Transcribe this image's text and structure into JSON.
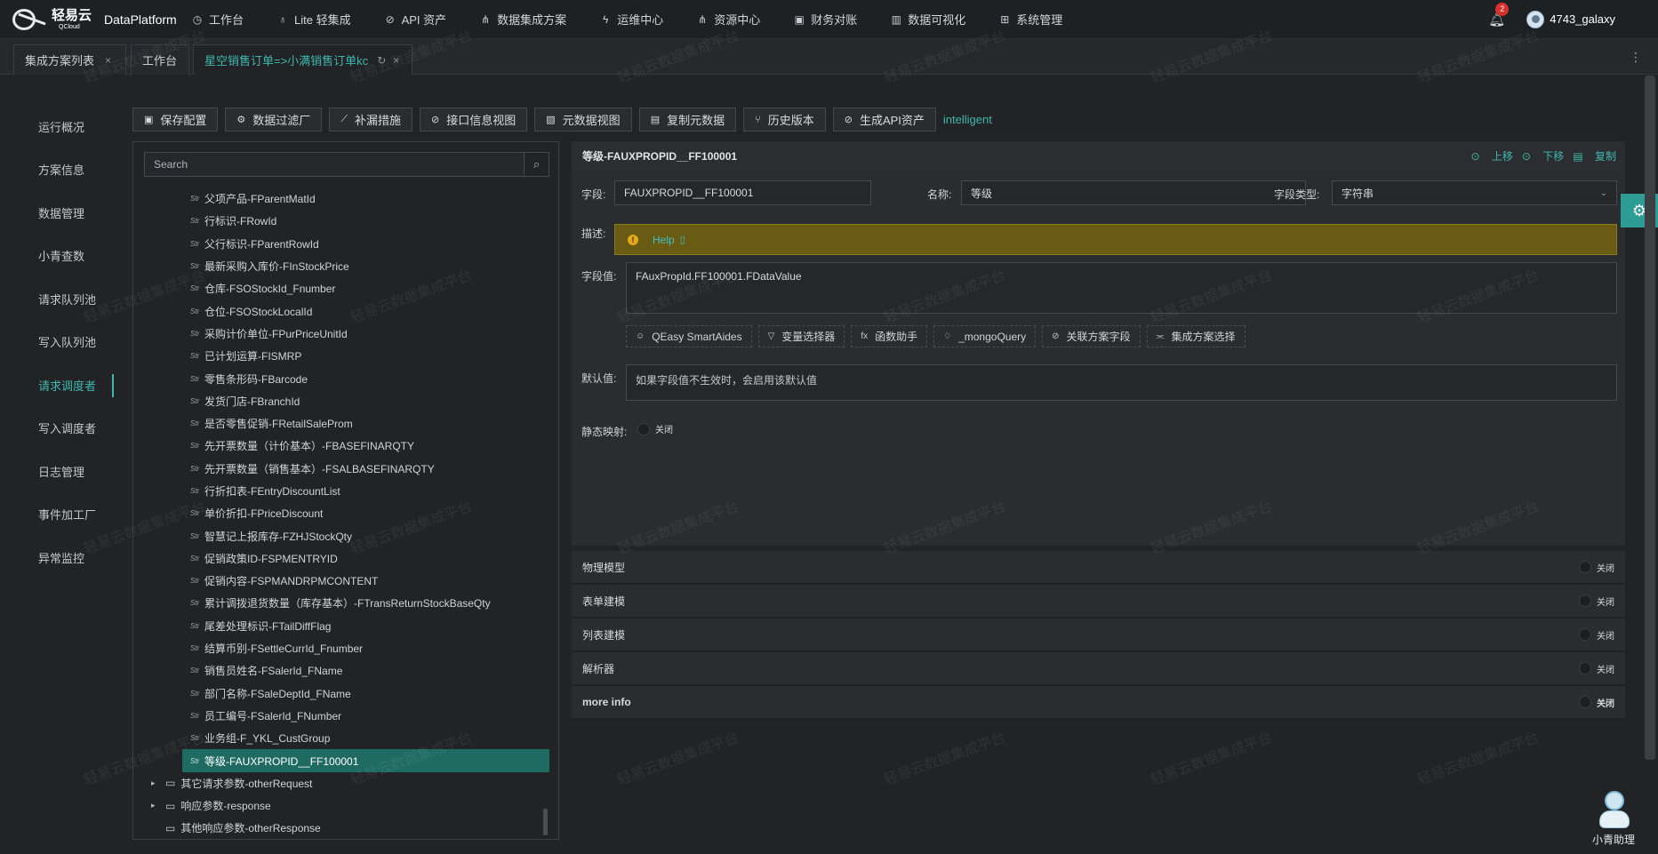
{
  "brand": {
    "logo_cn": "轻易云",
    "logo_en": "QCloud",
    "platform": "DataPlatform"
  },
  "nav": [
    {
      "icon": "clock-icon",
      "glyph": "◷",
      "label": "工作台"
    },
    {
      "icon": "bulb-icon",
      "glyph": "♁",
      "label": "Lite 轻集成"
    },
    {
      "icon": "api-icon",
      "glyph": "⊘",
      "label": "API 资产"
    },
    {
      "icon": "flow-icon",
      "glyph": "⋔",
      "label": "数据集成方案"
    },
    {
      "icon": "bolt-icon",
      "glyph": "ϟ",
      "label": "运维中心"
    },
    {
      "icon": "resource-icon",
      "glyph": "⋔",
      "label": "资源中心"
    },
    {
      "icon": "finance-icon",
      "glyph": "▣",
      "label": "财务对账"
    },
    {
      "icon": "chart-icon",
      "glyph": "▥",
      "label": "数据可视化"
    },
    {
      "icon": "system-icon",
      "glyph": "⊞",
      "label": "系统管理"
    }
  ],
  "header": {
    "notification_count": "2",
    "username": "4743_galaxy"
  },
  "tabs": [
    {
      "label": "集成方案列表"
    },
    {
      "label": "工作台"
    },
    {
      "label": "星空销售订单=>小满销售订单kc"
    }
  ],
  "side_menu": [
    "运行概况",
    "方案信息",
    "数据管理",
    "小青查数",
    "请求队列池",
    "写入队列池",
    "请求调度者",
    "写入调度者",
    "日志管理",
    "事件加工厂",
    "异常监控"
  ],
  "toolbar": {
    "buttons": [
      {
        "icon": "save-icon",
        "glyph": "▣",
        "label": "保存配置"
      },
      {
        "icon": "gear-icon",
        "glyph": "⚙",
        "label": "数据过滤厂"
      },
      {
        "icon": "patch-icon",
        "glyph": "⟋",
        "label": "补漏措施"
      },
      {
        "icon": "link-icon",
        "glyph": "⊘",
        "label": "接口信息视图"
      },
      {
        "icon": "meta-icon",
        "glyph": "▧",
        "label": "元数据视图"
      },
      {
        "icon": "copy-icon",
        "glyph": "▤",
        "label": "复制元数据"
      },
      {
        "icon": "branch-icon",
        "glyph": "⑂",
        "label": "历史版本"
      },
      {
        "icon": "api-gen-icon",
        "glyph": "⊘",
        "label": "生成API资产"
      }
    ],
    "intelligent": "intelligent"
  },
  "tree": {
    "search_placeholder": "Search",
    "leaf_tag": "Str",
    "leaves": [
      "父项产品-FParentMatId",
      "行标识-FRowId",
      "父行标识-FParentRowId",
      "最新采购入库价-FInStockPrice",
      "仓库-FSOStockId_Fnumber",
      "仓位-FSOStockLocalId",
      "采购计价单位-FPurPriceUnitId",
      "已计划运算-FISMRP",
      "零售条形码-FBarcode",
      "发货门店-FBranchId",
      "是否零售促销-FRetailSaleProm",
      "先开票数量（计价基本）-FBASEFINARQTY",
      "先开票数量（销售基本）-FSALBASEFINARQTY",
      "行折扣表-FEntryDiscountList",
      "单价折扣-FPriceDiscount",
      "智慧记上报库存-FZHJStockQty",
      "促销政策ID-FSPMENTRYID",
      "促销内容-FSPMANDRPMCONTENT",
      "累计调拨退货数量（库存基本）-FTransReturnStockBaseQty",
      "尾差处理标识-FTailDiffFlag",
      "结算币别-FSettleCurrId_Fnumber",
      "销售员姓名-FSalerId_FName",
      "部门名称-FSaleDeptId_FName",
      "员工编号-FSalerId_FNumber",
      "业务组-F_YKL_CustGroup"
    ],
    "selected": "等级-FAUXPROPID__FF100001",
    "folders": [
      {
        "label": "其它请求参数-otherRequest",
        "expandable": true
      },
      {
        "label": "响应参数-response",
        "expandable": true
      },
      {
        "label": "其他响应参数-otherResponse",
        "expandable": false
      }
    ]
  },
  "detail": {
    "title": "等级-FAUXPROPID__FF100001",
    "actions": {
      "up": "上移",
      "down": "下移",
      "copy": "复制"
    },
    "field_label": "字段:",
    "field_value": "FAUXPROPID__FF100001",
    "name_label": "名称:",
    "name_value": "等级",
    "type_label": "字段类型:",
    "type_value": "字符串",
    "desc_label": "描述:",
    "help_text": "Help",
    "value_label": "字段值:",
    "value_text": "FAuxPropId.FF100001.FDataValue",
    "aides": [
      {
        "icon": "robot-icon",
        "glyph": "☺",
        "label": "QEasy SmartAides"
      },
      {
        "icon": "filter-icon",
        "glyph": "▽",
        "label": "变量选择器"
      },
      {
        "icon": "fx-icon",
        "glyph": "fx",
        "label": "函数助手"
      },
      {
        "icon": "bulb-icon",
        "glyph": "♢",
        "label": "_mongoQuery"
      },
      {
        "icon": "link-icon",
        "glyph": "⊘",
        "label": "关联方案字段"
      },
      {
        "icon": "flow-icon",
        "glyph": "⫘",
        "label": "集成方案选择"
      }
    ],
    "default_label": "默认值:",
    "default_placeholder": "如果字段值不生效时，会启用该默认值",
    "static_label": "静态映射:",
    "static_state": "关闭"
  },
  "sections": [
    {
      "label": "物理模型",
      "state": "关闭",
      "bold": false
    },
    {
      "label": "表单建模",
      "state": "关闭",
      "bold": false
    },
    {
      "label": "列表建模",
      "state": "关闭",
      "bold": false
    },
    {
      "label": "解析器",
      "state": "关闭",
      "bold": false
    },
    {
      "label": "more info",
      "state": "关闭",
      "bold": true
    }
  ],
  "assistant": {
    "name": "小青助理"
  },
  "watermark": "轻易云数据集成平台"
}
